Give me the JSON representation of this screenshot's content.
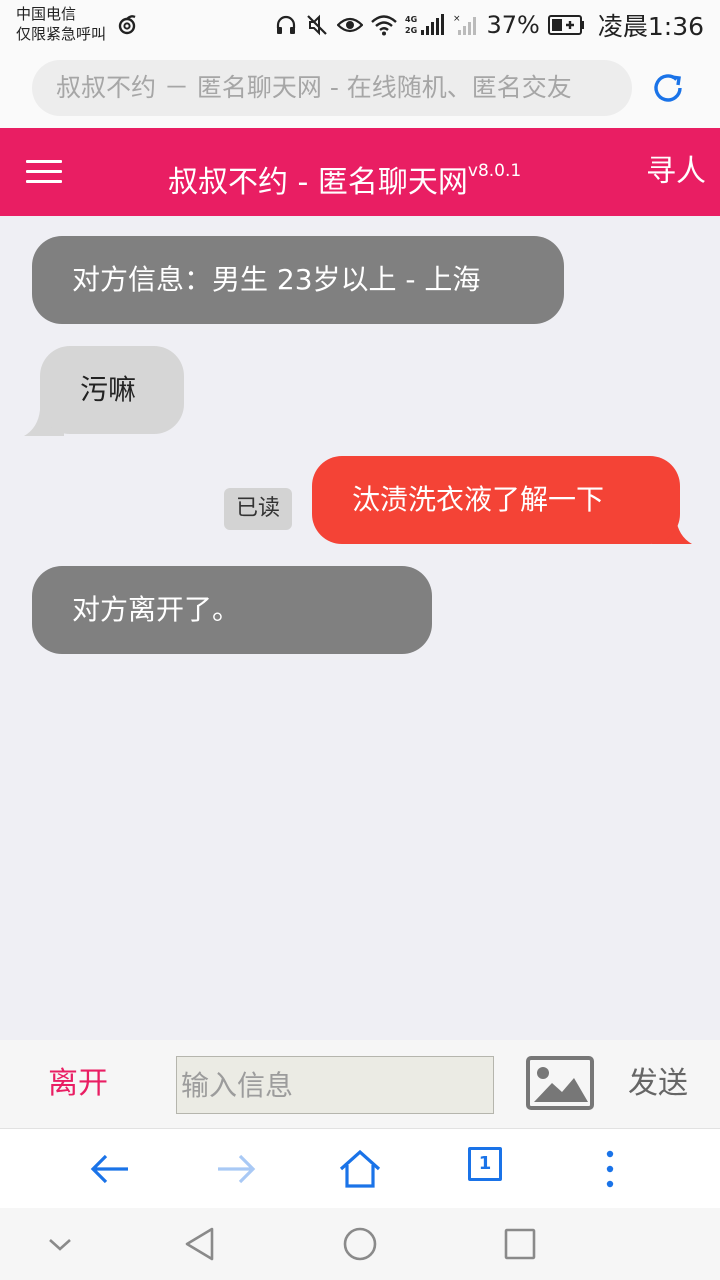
{
  "status_bar": {
    "carrier_line1": "中国电信",
    "carrier_line2": "仅限紧急呼叫",
    "battery_percent": "37%",
    "time": "凌晨1:36",
    "icons": [
      "carrier-logo-icon",
      "headset-icon",
      "mute-icon",
      "eye-icon",
      "wifi-icon",
      "signal-4g-icon",
      "signal-no-sim-icon",
      "battery-icon"
    ]
  },
  "browser": {
    "url_text": "叔叔不约 －   匿名聊天网 - 在线随机、匿名交友",
    "reload_icon": "reload-icon",
    "accent_color": "#1a73e8",
    "toolbar": {
      "tab_count": "1",
      "icons": [
        "back-arrow-icon",
        "forward-arrow-icon",
        "home-icon",
        "tabs-icon",
        "more-menu-icon"
      ]
    }
  },
  "header": {
    "menu_icon": "hamburger-menu-icon",
    "title": "叔叔不约 - 匿名聊天网",
    "version": "v8.0.1",
    "right_action": "寻人",
    "color": "#e91e63"
  },
  "messages": [
    {
      "type": "system",
      "text": "对方信息：男生 23岁以上 - 上海"
    },
    {
      "type": "incoming",
      "text": "污嘛"
    },
    {
      "type": "outgoing",
      "text": "汰渍洗衣液了解一下",
      "status": "已读"
    },
    {
      "type": "system",
      "text": "对方离开了。"
    }
  ],
  "message_colors": {
    "system": "#808080",
    "incoming": "#d6d6d6",
    "outgoing": "#f44336"
  },
  "input_bar": {
    "leave_label": "离开",
    "input_placeholder": "输入信息",
    "input_value": "",
    "image_icon": "image-icon",
    "send_label": "发送"
  },
  "nav_bar": {
    "icons": [
      "collapse-chevron-icon",
      "back-triangle-icon",
      "home-circle-icon",
      "recents-square-icon"
    ]
  }
}
